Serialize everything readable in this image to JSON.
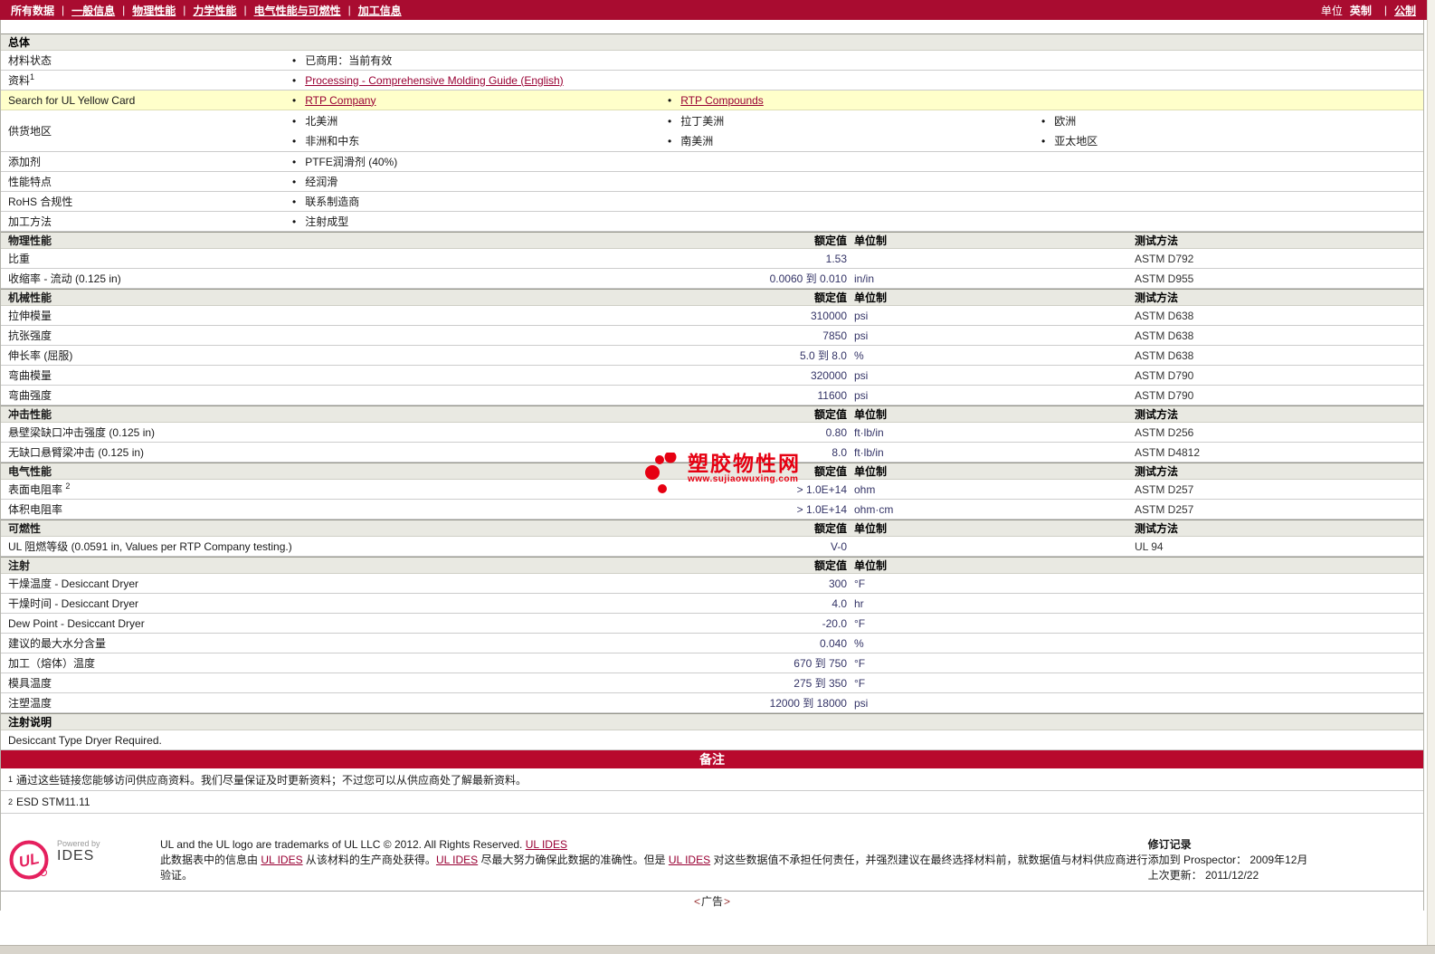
{
  "colors": {
    "nav_bg": "#a90c30",
    "notes_banner_bg": "#b8092d",
    "link": "#990033",
    "value_text": "#333366",
    "highlight_row": "#ffffca",
    "watermark_red": "#e60012",
    "ul_logo_pink": "#e5205e"
  },
  "nav": {
    "all_data": "所有数据",
    "links": {
      "general": "一般信息",
      "physical": "物理性能",
      "mechanical": "力学性能",
      "electrical_flammability": "电气性能与可燃性",
      "processing": "加工信息"
    },
    "units_label": "单位",
    "imperial": "英制",
    "metric": "公制"
  },
  "general": {
    "header": "总体",
    "material_status_label": "材料状态",
    "material_status_value": "已商用：当前有效",
    "resources_label": "资料",
    "resources_sup": "1",
    "resources_value": "Processing - Comprehensive Molding Guide (English)",
    "yellowcard_label": "Search for UL Yellow Card",
    "yellowcard_value1": "RTP Company",
    "yellowcard_value2": "RTP Compounds",
    "availability_label": "供货地区",
    "availability": {
      "c1r1": "北美洲",
      "c1r2": "非洲和中东",
      "c2r1": "拉丁美洲",
      "c2r2": "南美洲",
      "c3r1": "欧洲",
      "c3r2": "亚太地区"
    },
    "additive_label": "添加剂",
    "additive_value": "PTFE润滑剂 (40%)",
    "features_label": "性能特点",
    "features_value": "经润滑",
    "rohs_label": "RoHS 合规性",
    "rohs_value": "联系制造商",
    "processing_label": "加工方法",
    "processing_value": "注射成型"
  },
  "col_headers": {
    "value": "额定值",
    "unit": "单位制",
    "method": "测试方法"
  },
  "physical": {
    "header": "物理性能",
    "rows": [
      {
        "label": "比重",
        "value": "1.53",
        "unit": "",
        "method": "ASTM D792"
      },
      {
        "label": "收缩率  - 流动 (0.125 in)",
        "value": "0.0060 到  0.010",
        "unit": "in/in",
        "method": "ASTM D955"
      }
    ]
  },
  "mechanical": {
    "header": "机械性能",
    "rows": [
      {
        "label": "拉伸模量",
        "value": "310000",
        "unit": "psi",
        "method": "ASTM D638"
      },
      {
        "label": "抗张强度",
        "value": "7850",
        "unit": "psi",
        "method": "ASTM D638"
      },
      {
        "label": "伸长率 (屈服)",
        "value": "5.0 到  8.0",
        "unit": "%",
        "method": "ASTM D638"
      },
      {
        "label": "弯曲模量",
        "value": "320000",
        "unit": "psi",
        "method": "ASTM D790"
      },
      {
        "label": "弯曲强度",
        "value": "11600",
        "unit": "psi",
        "method": "ASTM D790"
      }
    ]
  },
  "impact": {
    "header": "冲击性能",
    "rows": [
      {
        "label": "悬壁梁缺口冲击强度  (0.125 in)",
        "value": "0.80",
        "unit": "ft·lb/in",
        "method": "ASTM D256"
      },
      {
        "label": "无缺口悬臂梁冲击  (0.125 in)",
        "value": "8.0",
        "unit": "ft·lb/in",
        "method": "ASTM D4812"
      }
    ]
  },
  "electrical": {
    "header": "电气性能",
    "rows": [
      {
        "label": "表面电阻率",
        "sup": "2",
        "value": "> 1.0E+14",
        "unit": "ohm",
        "method": "ASTM D257"
      },
      {
        "label": "体积电阻率",
        "sup": "",
        "value": "> 1.0E+14",
        "unit": "ohm·cm",
        "method": "ASTM D257"
      }
    ]
  },
  "flammability": {
    "header": "可燃性",
    "rows": [
      {
        "label": "UL 阻燃等级  (0.0591 in, Values per RTP Company testing.)",
        "value": "V-0",
        "unit": "",
        "method": "UL 94"
      }
    ]
  },
  "injection": {
    "header": "注射",
    "rows": [
      {
        "label": "干燥温度  - Desiccant Dryer",
        "value": "300",
        "unit": "°F"
      },
      {
        "label": "干燥时间  - Desiccant Dryer",
        "value": "4.0",
        "unit": "hr"
      },
      {
        "label": "Dew Point - Desiccant Dryer",
        "value": "-20.0",
        "unit": "°F"
      },
      {
        "label": "建议的最大水分含量",
        "value": "0.040",
        "unit": "%"
      },
      {
        "label": "加工（熔体）温度",
        "value": "670 到  750",
        "unit": "°F"
      },
      {
        "label": "模具温度",
        "value": "275 到  350",
        "unit": "°F"
      },
      {
        "label": "注塑温度",
        "value": "12000 到  18000",
        "unit": "psi"
      }
    ]
  },
  "injection_notes": {
    "header": "注射说明",
    "text": "Desiccant Type Dryer Required."
  },
  "notes": {
    "banner": "备注",
    "fn1_sup": "1",
    "fn1": "通过这些链接您能够访问供应商资料。我们尽量保证及时更新资料；不过您可以从供应商处了解最新资料。",
    "fn2_sup": "2",
    "fn2": "ESD STM11.11"
  },
  "watermark": {
    "name": "塑胶物性网",
    "url": "www.sujiaowuxing.com"
  },
  "footer": {
    "ul_logo_text": "UL",
    "powered_by": "Powered by",
    "ides": "IDES",
    "line1_text": "UL and the UL logo are trademarks of UL LLC © 2012. All Rights Reserved.",
    "line1_link": "UL IDES",
    "l2p1": "此数据表中的信息由  ",
    "l2l1": "UL IDES",
    "l2p2": " 从该材料的生产商处获得。",
    "l2l2": "UL IDES",
    "l2p3": " 尽最大努力确保此数据的准确性。但是  ",
    "l2l3": "UL IDES",
    "l2p4": " 对这些数据值不承担任何责任，并强烈建议在最终选择材料前，就数据值与材料供应商进行验证。",
    "revision_header": "修订记录",
    "added_label": "添加到  Prospector：",
    "added_value": "2009年12月",
    "updated_label": "上次更新：",
    "updated_value": "2011/12/22"
  },
  "ad": {
    "open": "<",
    "text": "广告",
    "close": ">"
  }
}
